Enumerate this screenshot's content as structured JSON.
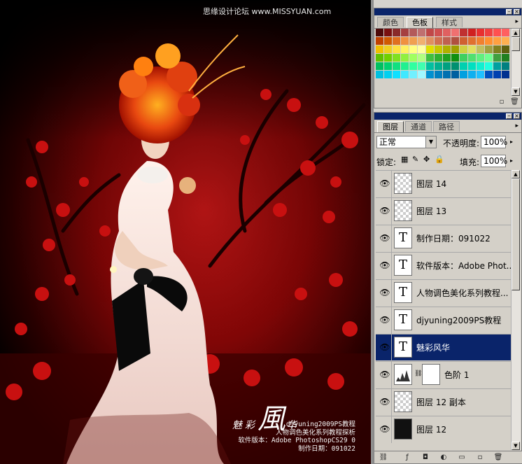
{
  "canvas": {
    "watermark": "思缘设计论坛 www.MISSYUAN.com",
    "art_title_small_1": "魅",
    "art_title_small_2": "彩",
    "art_title_big": "風",
    "art_title_small_3": "华",
    "credits": [
      "djyuning2009PS教程",
      "人物调色美化系列教程探析",
      "软件版本：Adobe PhotoshopCS29 0",
      "制作日期：091022"
    ]
  },
  "swatches_panel": {
    "tabs": [
      "颜色",
      "色板",
      "样式"
    ],
    "active_tab": 1,
    "colors": [
      "#4d0a0a",
      "#7a1010",
      "#8a2a2a",
      "#a64040",
      "#b35a5a",
      "#c07070",
      "#c04848",
      "#d05050",
      "#e06060",
      "#f07070",
      "#c03030",
      "#d02020",
      "#e83030",
      "#f04040",
      "#ff5050",
      "#ff6060",
      "#c04000",
      "#d05a00",
      "#e07020",
      "#f09040",
      "#f0a050",
      "#f0b070",
      "#e09060",
      "#d07050",
      "#c06050",
      "#b05040",
      "#d06030",
      "#e07030",
      "#f08030",
      "#ff9030",
      "#ffa040",
      "#ffb050",
      "#f0c000",
      "#f0d020",
      "#ffe040",
      "#fff060",
      "#ffff80",
      "#ffffa0",
      "#e0e000",
      "#c8c800",
      "#b0b000",
      "#a0a000",
      "#d0d040",
      "#e0e060",
      "#c0c060",
      "#a0a040",
      "#808020",
      "#606010",
      "#60c000",
      "#70d000",
      "#80e020",
      "#90f040",
      "#a0ff60",
      "#b0ff80",
      "#40c040",
      "#30b030",
      "#20a020",
      "#109010",
      "#40d060",
      "#50e070",
      "#60f080",
      "#70ff90",
      "#40a040",
      "#208020",
      "#00c060",
      "#00d070",
      "#10e080",
      "#20f090",
      "#30ffa0",
      "#40ffb0",
      "#00c0a0",
      "#00b090",
      "#00a080",
      "#009070",
      "#00d0b0",
      "#00e0c0",
      "#10f0d0",
      "#20ffe0",
      "#00a0a0",
      "#008080",
      "#00c0e0",
      "#00d0f0",
      "#10e0ff",
      "#40e8ff",
      "#70f0ff",
      "#a0f8ff",
      "#0090d0",
      "#0080c0",
      "#0070b0",
      "#0060a0",
      "#00a0e0",
      "#10b0f0",
      "#20c0ff",
      "#0050c0",
      "#0040b0",
      "#003090"
    ]
  },
  "layers_panel": {
    "tabs": [
      "图层",
      "通道",
      "路径"
    ],
    "active_tab": 0,
    "blend_mode": "正常",
    "opacity_label": "不透明度:",
    "opacity_value": "100%",
    "lock_label": "锁定:",
    "fill_label": "填充:",
    "fill_value": "100%",
    "layers": [
      {
        "name": "图层 14",
        "thumb": "transparent",
        "selected": false
      },
      {
        "name": "图层 13",
        "thumb": "transparent",
        "selected": false
      },
      {
        "name": "制作日期：091022",
        "thumb": "text",
        "selected": false
      },
      {
        "name": "软件版本：Adobe Phot...",
        "thumb": "text",
        "selected": false
      },
      {
        "name": "人物调色美化系列教程...",
        "thumb": "text",
        "selected": false
      },
      {
        "name": "djyuning2009PS教程",
        "thumb": "text",
        "selected": false
      },
      {
        "name": "魅彩风华",
        "thumb": "text",
        "selected": true
      },
      {
        "name": "色阶 1",
        "thumb": "adjustment",
        "selected": false
      },
      {
        "name": "图层 12 副本",
        "thumb": "transparent-small",
        "selected": false
      },
      {
        "name": "图层 12",
        "thumb": "image",
        "selected": false
      }
    ],
    "text_thumb_glyph": "T"
  }
}
